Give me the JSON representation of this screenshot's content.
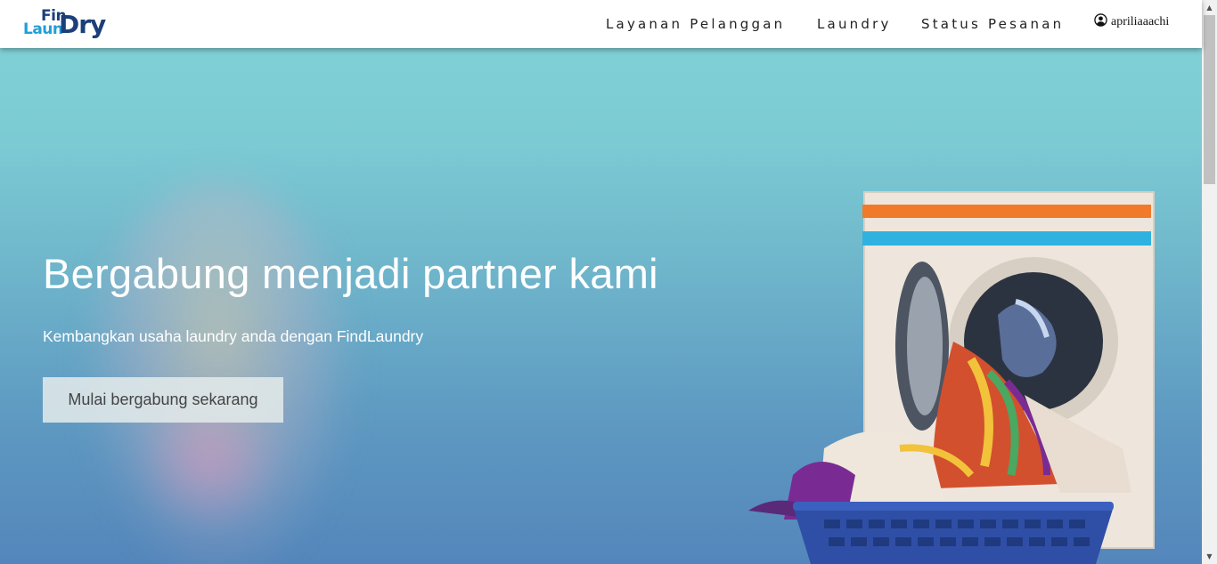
{
  "brand": {
    "logo_part1": "Fin",
    "logo_part2": "Laun",
    "logo_part3": "Dry"
  },
  "nav": {
    "items": [
      {
        "label": "Layanan Pelanggan"
      },
      {
        "label": "Laundry"
      },
      {
        "label": "Status Pesanan"
      }
    ],
    "user": {
      "username": "apriliaaachi",
      "icon": "user-circle-icon"
    }
  },
  "hero": {
    "title": "Bergabung menjadi partner kami",
    "subtitle": "Kembangkan usaha laundry anda dengan FindLaundry",
    "cta_label": "Mulai bergabung sekarang"
  },
  "colors": {
    "brand_dark": "#1c3f7a",
    "brand_light": "#1f9fd6",
    "hero_top": "#7fd0d6",
    "hero_bottom": "#5486bb"
  }
}
